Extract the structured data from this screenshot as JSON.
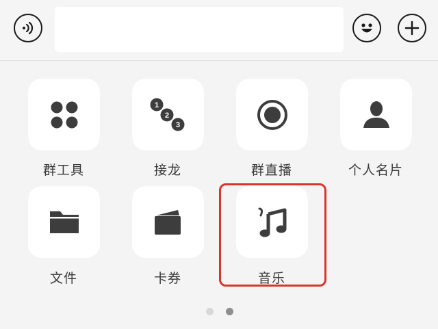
{
  "input_bar": {
    "voice_icon": "voice-icon",
    "text_value": "",
    "emoji_icon": "smiley-icon",
    "plus_icon": "plus-icon"
  },
  "apps": [
    {
      "label": "群工具",
      "icon": "four-dots-icon"
    },
    {
      "label": "接龙",
      "icon": "numbered-chain-icon"
    },
    {
      "label": "群直播",
      "icon": "record-icon"
    },
    {
      "label": "个人名片",
      "icon": "person-icon"
    },
    {
      "label": "文件",
      "icon": "folder-icon"
    },
    {
      "label": "卡券",
      "icon": "wallet-icon"
    },
    {
      "label": "音乐",
      "icon": "music-note-icon"
    }
  ],
  "chain_numbers": [
    "1",
    "2",
    "3"
  ],
  "highlighted_item": "音乐",
  "pagination": {
    "pages": 2,
    "current": 2
  },
  "colors": {
    "background": "#f4f4f4",
    "tile": "#ffffff",
    "icon": "#3d3d3d",
    "highlight": "#d9352b",
    "dot_active": "#8e8e8e",
    "dot_inactive": "#d8d8d8"
  }
}
